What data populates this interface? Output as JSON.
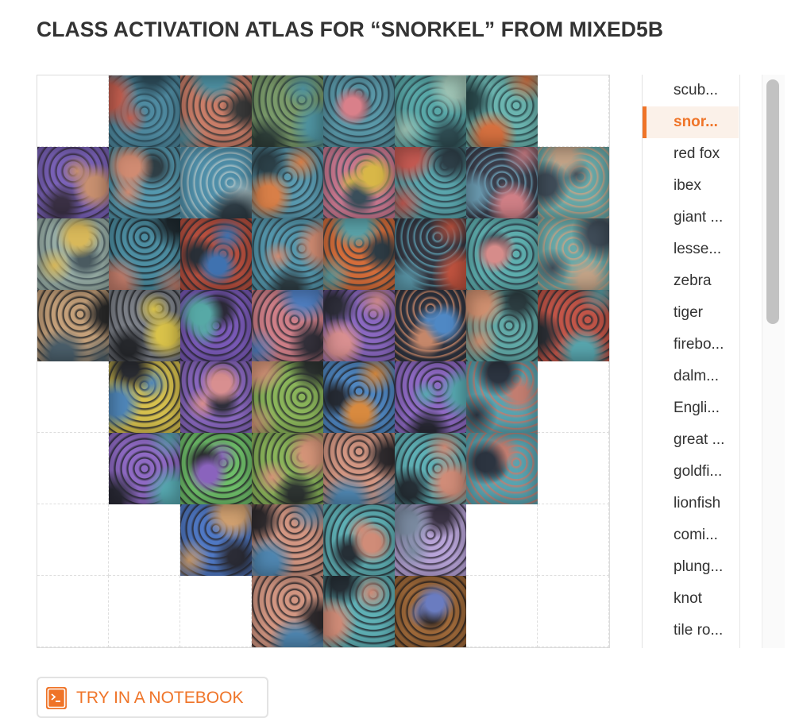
{
  "page": {
    "title": "CLASS ACTIVATION ATLAS FOR “SNORKEL” FROM MIXED5B"
  },
  "atlas": {
    "grid_size": 8,
    "tiles": [
      {
        "row": 0,
        "col": 1,
        "palette": "water-red"
      },
      {
        "row": 0,
        "col": 2,
        "palette": "skin-water"
      },
      {
        "row": 0,
        "col": 3,
        "palette": "green-water"
      },
      {
        "row": 0,
        "col": 4,
        "palette": "water-pink"
      },
      {
        "row": 0,
        "col": 5,
        "palette": "teal-water"
      },
      {
        "row": 0,
        "col": 6,
        "palette": "teal-orange"
      },
      {
        "row": 1,
        "col": 0,
        "palette": "purple-sand"
      },
      {
        "row": 1,
        "col": 1,
        "palette": "water-skin"
      },
      {
        "row": 1,
        "col": 2,
        "palette": "water-dark"
      },
      {
        "row": 1,
        "col": 3,
        "palette": "water-orange"
      },
      {
        "row": 1,
        "col": 4,
        "palette": "pink-yellow"
      },
      {
        "row": 1,
        "col": 5,
        "palette": "teal-red"
      },
      {
        "row": 1,
        "col": 6,
        "palette": "dark-pink"
      },
      {
        "row": 1,
        "col": 7,
        "palette": "teal-dots"
      },
      {
        "row": 2,
        "col": 0,
        "palette": "sand-gold"
      },
      {
        "row": 2,
        "col": 1,
        "palette": "face-dark"
      },
      {
        "row": 2,
        "col": 2,
        "palette": "red-blue"
      },
      {
        "row": 2,
        "col": 3,
        "palette": "water-skin"
      },
      {
        "row": 2,
        "col": 4,
        "palette": "orange-teal"
      },
      {
        "row": 2,
        "col": 5,
        "palette": "dark-red"
      },
      {
        "row": 2,
        "col": 6,
        "palette": "teal-pink"
      },
      {
        "row": 2,
        "col": 7,
        "palette": "teal-dots"
      },
      {
        "row": 3,
        "col": 0,
        "palette": "sand-dots"
      },
      {
        "row": 3,
        "col": 1,
        "palette": "gray-yellow"
      },
      {
        "row": 3,
        "col": 2,
        "palette": "purple-teal"
      },
      {
        "row": 3,
        "col": 3,
        "palette": "pink-blue"
      },
      {
        "row": 3,
        "col": 4,
        "palette": "purple-pink"
      },
      {
        "row": 3,
        "col": 5,
        "palette": "dark-blue"
      },
      {
        "row": 3,
        "col": 6,
        "palette": "teal-skin"
      },
      {
        "row": 3,
        "col": 7,
        "palette": "red-teal"
      },
      {
        "row": 4,
        "col": 1,
        "palette": "yellow-blue"
      },
      {
        "row": 4,
        "col": 2,
        "palette": "purple-pink"
      },
      {
        "row": 4,
        "col": 3,
        "palette": "green-skin"
      },
      {
        "row": 4,
        "col": 4,
        "palette": "blue-orange"
      },
      {
        "row": 4,
        "col": 5,
        "palette": "purple-mask"
      },
      {
        "row": 4,
        "col": 6,
        "palette": "teal-dark"
      },
      {
        "row": 5,
        "col": 1,
        "palette": "purple-mask"
      },
      {
        "row": 5,
        "col": 2,
        "palette": "green-mask"
      },
      {
        "row": 5,
        "col": 3,
        "palette": "green-skin"
      },
      {
        "row": 5,
        "col": 4,
        "palette": "skin-mask"
      },
      {
        "row": 5,
        "col": 5,
        "palette": "teal-mask"
      },
      {
        "row": 5,
        "col": 6,
        "palette": "teal-dark"
      },
      {
        "row": 6,
        "col": 2,
        "palette": "blue-mask"
      },
      {
        "row": 6,
        "col": 3,
        "palette": "skin-mask"
      },
      {
        "row": 6,
        "col": 4,
        "palette": "teal-mask"
      },
      {
        "row": 6,
        "col": 5,
        "palette": "lavender-shell"
      },
      {
        "row": 7,
        "col": 3,
        "palette": "skin-mask"
      },
      {
        "row": 7,
        "col": 4,
        "palette": "teal-mask"
      },
      {
        "row": 7,
        "col": 5,
        "palette": "brown-shell"
      }
    ]
  },
  "palettes": {
    "water-red": [
      "#4f8aa0",
      "#c25e4f",
      "#2d4c5a"
    ],
    "skin-water": [
      "#c97d68",
      "#4e91a3",
      "#3a3a3a"
    ],
    "green-water": [
      "#7a9a6a",
      "#4f93a0",
      "#2f3f3a"
    ],
    "water-pink": [
      "#5a98a8",
      "#d9808a",
      "#2d4550"
    ],
    "teal-water": [
      "#59a8a8",
      "#9fc4b5",
      "#2f4c52"
    ],
    "teal-orange": [
      "#6bb5b0",
      "#d5703f",
      "#2b4a4d"
    ],
    "purple-sand": [
      "#7a62b8",
      "#c89070",
      "#3a3044"
    ],
    "water-skin": [
      "#5598ae",
      "#d08b72",
      "#2f3e45"
    ],
    "water-dark": [
      "#4f8ea8",
      "#2f3d46",
      "#a8c0c5"
    ],
    "water-orange": [
      "#5a9ab0",
      "#d87f48",
      "#2c4048"
    ],
    "pink-yellow": [
      "#c97890",
      "#d8b748",
      "#3a4e5a"
    ],
    "teal-red": [
      "#5aa5ac",
      "#c55a52",
      "#2e3f48"
    ],
    "dark-pink": [
      "#3a3d4a",
      "#cf7f86",
      "#6a9ab0"
    ],
    "teal-dots": [
      "#67a8a8",
      "#3f4c58",
      "#c4a488"
    ],
    "sand-gold": [
      "#9ab0a8",
      "#d8b85a",
      "#4a5a60"
    ],
    "face-dark": [
      "#4d8ea2",
      "#c47e6c",
      "#1f2a30"
    ],
    "red-blue": [
      "#b9503f",
      "#3f72b0",
      "#2a3038"
    ],
    "orange-teal": [
      "#d46d3a",
      "#5aa2a8",
      "#2e3c45"
    ],
    "dark-red": [
      "#343640",
      "#c0533f",
      "#5a96a8"
    ],
    "teal-pink": [
      "#5fb0b0",
      "#d68c8a",
      "#2f3c48"
    ],
    "sand-dots": [
      "#c4a07a",
      "#4a5e6a",
      "#2a2a2a"
    ],
    "gray-yellow": [
      "#7c8088",
      "#d9c24a",
      "#26282c"
    ],
    "purple-teal": [
      "#7a5ab8",
      "#57a9a6",
      "#2c2a38"
    ],
    "pink-blue": [
      "#cf7f88",
      "#4f7ec0",
      "#33303a"
    ],
    "purple-pink": [
      "#8a68c0",
      "#d88f90",
      "#2e2e3a"
    ],
    "dark-blue": [
      "#2f3440",
      "#4f88c4",
      "#c5876a"
    ],
    "teal-skin": [
      "#62aaa8",
      "#d09070",
      "#2c3c40"
    ],
    "red-teal": [
      "#c25548",
      "#58a5ad",
      "#2c3036"
    ],
    "yellow-blue": [
      "#d6c04e",
      "#4f86b8",
      "#2a2c32"
    ],
    "green-skin": [
      "#8ab45a",
      "#d49478",
      "#2e3432"
    ],
    "blue-orange": [
      "#4f86c0",
      "#d88a3f",
      "#262b34"
    ],
    "purple-mask": [
      "#8f6ac4",
      "#57a8b0",
      "#2a2a36"
    ],
    "teal-dark": [
      "#57a3b0",
      "#2c3440",
      "#c27d70"
    ],
    "green-mask": [
      "#6fbf6a",
      "#8a63bd",
      "#2a2d2f"
    ],
    "skin-mask": [
      "#d29682",
      "#4f86b0",
      "#2f2b2e"
    ],
    "teal-mask": [
      "#5fb0b5",
      "#d08c78",
      "#262f36"
    ],
    "blue-mask": [
      "#4f78c4",
      "#d0a070",
      "#2b2c36"
    ],
    "lavender-shell": [
      "#b8a4d8",
      "#7a8aa0",
      "#3a3344"
    ],
    "brown-shell": [
      "#a06a3a",
      "#6a7cc0",
      "#2c2522"
    ]
  },
  "class_list": {
    "items": [
      "scub...",
      "snor...",
      "red fox",
      "ibex",
      "giant ...",
      "lesse...",
      "zebra",
      "tiger",
      "firebo...",
      "dalm...",
      "Engli...",
      "great ...",
      "goldfi...",
      "lionfish",
      "comi...",
      "plung...",
      "knot",
      "tile ro..."
    ],
    "active_index": 1,
    "accent_color": "#ef7428"
  },
  "notebook_button": {
    "label": "TRY IN A NOTEBOOK",
    "icon": "terminal-icon"
  }
}
